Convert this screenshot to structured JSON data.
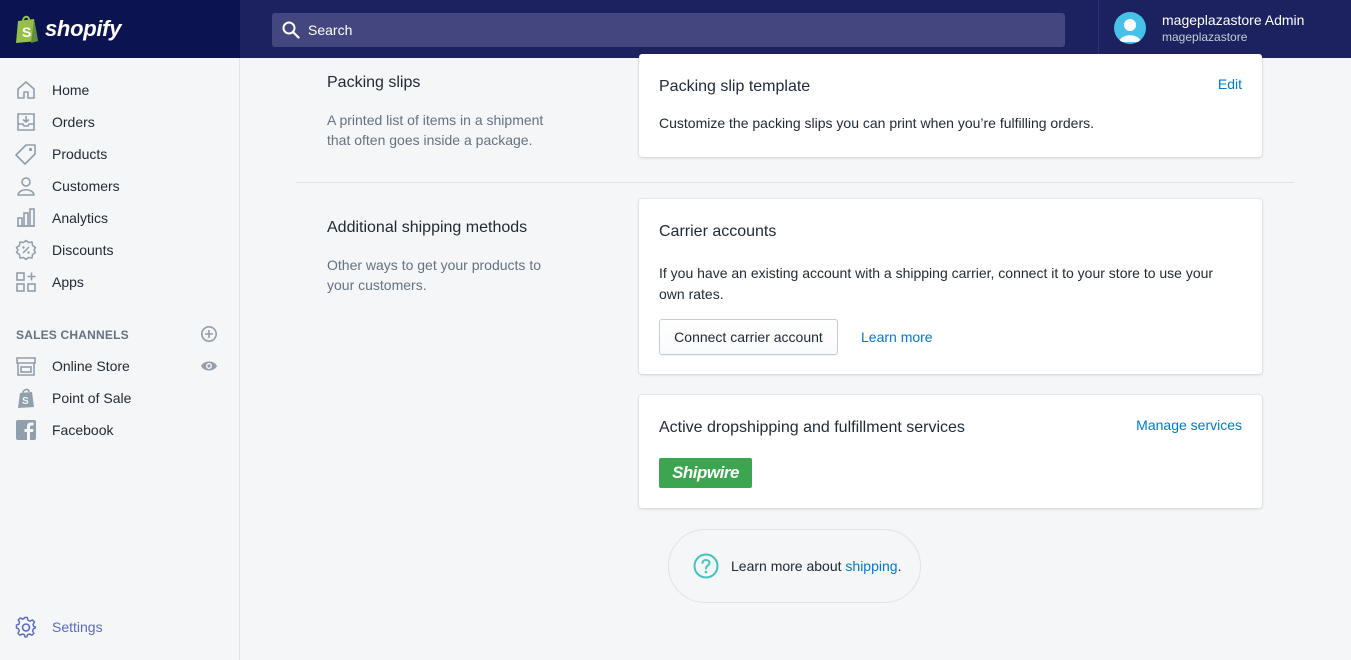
{
  "brand": {
    "name": "shopify",
    "bag_color": "#95bf47"
  },
  "search": {
    "placeholder": "Search"
  },
  "user": {
    "name": "mageplazastore Admin",
    "store": "mageplazastore"
  },
  "sidebar": {
    "items": [
      {
        "label": "Home",
        "icon": "home-icon"
      },
      {
        "label": "Orders",
        "icon": "orders-icon"
      },
      {
        "label": "Products",
        "icon": "tag-icon"
      },
      {
        "label": "Customers",
        "icon": "person-icon"
      },
      {
        "label": "Analytics",
        "icon": "bar-chart-icon"
      },
      {
        "label": "Discounts",
        "icon": "discount-icon"
      },
      {
        "label": "Apps",
        "icon": "apps-icon"
      }
    ],
    "sales_channels_title": "SALES CHANNELS",
    "channels": [
      {
        "label": "Online Store",
        "icon": "store-icon"
      },
      {
        "label": "Point of Sale",
        "icon": "pos-icon"
      },
      {
        "label": "Facebook",
        "icon": "facebook-icon"
      }
    ],
    "settings_label": "Settings"
  },
  "sections": {
    "packing": {
      "title": "Packing slips",
      "description": "A printed list of items in a shipment that often goes inside a package.",
      "card_title": "Packing slip template",
      "card_action": "Edit",
      "card_text": "Customize the packing slips you can print when you’re fulfilling orders."
    },
    "additional": {
      "title": "Additional shipping methods",
      "description": "Other ways to get your products to your customers.",
      "carrier_title": "Carrier accounts",
      "carrier_text": "If you have an existing account with a shipping carrier, connect it to your store to use your own rates.",
      "connect_button": "Connect carrier account",
      "learn_more": "Learn more",
      "dropship_title": "Active dropshipping and fulfillment services",
      "manage_services": "Manage services",
      "shipwire_logo": "Shipwire"
    }
  },
  "help": {
    "prefix": "Learn more about ",
    "link": "shipping",
    "suffix": "."
  },
  "colors": {
    "topbar": "#1c2260",
    "accent": "#5c6ac4",
    "link": "#007ace",
    "shipwire": "#3ca54f"
  }
}
